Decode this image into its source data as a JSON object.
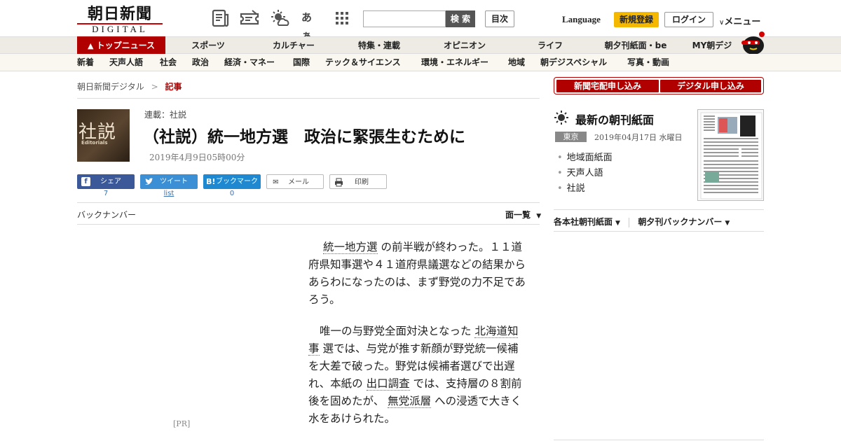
{
  "header": {
    "logo_kanji": "朝日新聞",
    "logo_sub": "DIGITAL",
    "icons": [
      "newspaper-icon",
      "coupon-icon",
      "weather-icon",
      "font-size-icon",
      "apps-grid-icon"
    ],
    "font_icon_text": "あぁ",
    "search_placeholder": "",
    "search_label": "検 索",
    "index_label": "目次",
    "language_label": "Language",
    "register_label": "新規登録",
    "login_label": "ログイン",
    "menu_label": "メニュー",
    "accent": "#b10000",
    "register_color": "#f5b800"
  },
  "nav_primary": {
    "top_label": "トップニュース",
    "items": [
      "スポーツ",
      "カルチャー",
      "特集・連載",
      "オピニオン",
      "ライフ",
      "朝夕刊紙面・be",
      "MY朝デジ"
    ]
  },
  "nav_secondary": {
    "items": [
      "新着",
      "天声人語",
      "社会",
      "政治",
      "経済・マネー",
      "国際",
      "テック＆サイエンス",
      "環境・エネルギー",
      "地域",
      "朝デジスペシャル",
      "写真・動画"
    ]
  },
  "breadcrumb": {
    "home": "朝日新聞デジタル",
    "sep": ">",
    "current": "記事"
  },
  "article": {
    "thumb_big": "社説",
    "thumb_small": "Editorials",
    "series": "連載：社説",
    "title": "（社説）統一地方選　政治に緊張生むために",
    "date": "2019年4月9日05時00分",
    "share": {
      "facebook_label": "シェア",
      "facebook_count": "7",
      "twitter_label": "ツイート",
      "twitter_count": "list",
      "hatena_label": "ブックマーク",
      "hatena_count": "0",
      "mail_label": "メール",
      "print_label": "印刷"
    },
    "backnumber_label": "バックナンバー",
    "list_label": "面一覧",
    "pr_label": "[PR]",
    "p1": {
      "link1": "統一地方選",
      "text1": " の前半戦が終わった。１１道府県知事選や４１道府県議選などの結果からあらわになったのは、まず野党の力不足であろう。"
    },
    "p2": {
      "text1": "唯一の与野党全面対決となった ",
      "link1": "北海道知事",
      "text2": " 選では、与党が推す新顔が野党統一候補を大差で破った。野党は候補者選びで出遅れ、本紙の ",
      "link2": "出口調査",
      "text3": " では、支持層の８割前後を固めたが、 ",
      "link3": "無党派層",
      "text4": " への浸透で大きく水をあけられた。"
    }
  },
  "sidebar": {
    "subscribe_paper": "新聞宅配申し込み",
    "subscribe_digital": "デジタル申し込み",
    "latest_title": "最新の朝刊紙面",
    "region": "東京",
    "paper_date": "2019年04月17日 水曜日",
    "links": [
      "地域面紙面",
      "天声人語",
      "社説"
    ],
    "tab1": "各本社朝刊紙面",
    "tab2": "朝夕刊バックナンバー"
  }
}
